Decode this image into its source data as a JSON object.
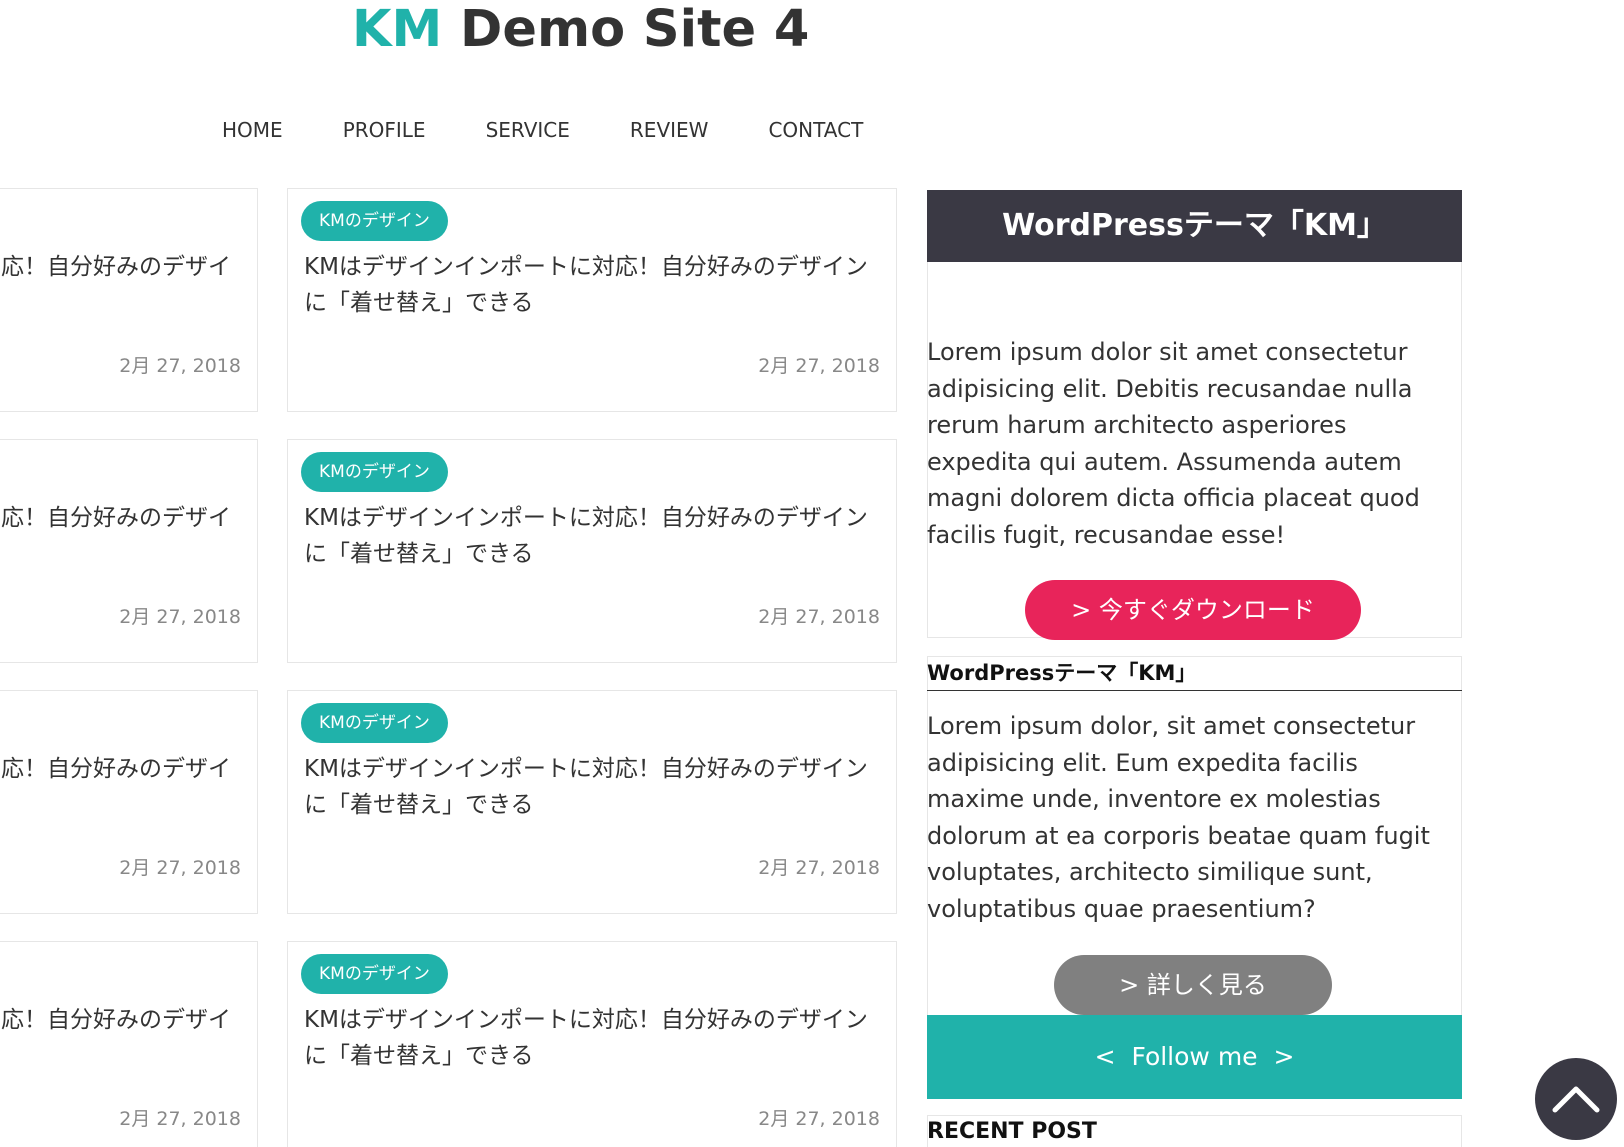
{
  "site": {
    "title_accent": "KM",
    "title_rest": " Demo Site 4"
  },
  "nav": [
    {
      "label": "HOME"
    },
    {
      "label": "PROFILE"
    },
    {
      "label": "SERVICE"
    },
    {
      "label": "REVIEW"
    },
    {
      "label": "CONTACT"
    }
  ],
  "posts_left": [
    {
      "title": "応！自分好みのデザイ",
      "date": "2月 27, 2018"
    },
    {
      "title": "応！自分好みのデザイ",
      "date": "2月 27, 2018"
    },
    {
      "title": "応！自分好みのデザイ",
      "date": "2月 27, 2018"
    },
    {
      "title": "応！自分好みのデザイ",
      "date": "2月 27, 2018"
    }
  ],
  "posts_right": [
    {
      "tag": "KMのデザイン",
      "title": "KMはデザインインポートに対応！自分好みのデザインに「着せ替え」できる",
      "date": "2月 27, 2018"
    },
    {
      "tag": "KMのデザイン",
      "title": "KMはデザインインポートに対応！自分好みのデザインに「着せ替え」できる",
      "date": "2月 27, 2018"
    },
    {
      "tag": "KMのデザイン",
      "title": "KMはデザインインポートに対応！自分好みのデザインに「着せ替え」できる",
      "date": "2月 27, 2018"
    },
    {
      "tag": "KMのデザイン",
      "title": "KMはデザインインポートに対応！自分好みのデザインに「着せ替え」できる",
      "date": "2月 27, 2018"
    }
  ],
  "sidebar": {
    "widget1": {
      "title": "WordPressテーマ「KM」",
      "text": "Lorem ipsum dolor sit amet consectetur adipisicing elit. Debitis recusandae nulla rerum harum architecto asperiores expedita qui autem. Assumenda autem magni dolorem dicta officia placeat quod facilis fugit, recusandae esse!",
      "button": "> 今すぐダウンロード"
    },
    "widget2": {
      "title": "WordPressテーマ「KM」",
      "text": "Lorem ipsum dolor, sit amet consectetur adipisicing elit. Eum expedita facilis maxime unde, inventore ex molestias dolorum at ea corporis beatae quam fugit voluptates, architecto similique sunt, voluptatibus quae praesentium?",
      "button": "> 詳しく見る"
    },
    "follow": "<  Follow me  >",
    "recent_title": "RECENT POST"
  },
  "icons": {
    "back_to_top": "chevron-up-icon"
  },
  "colors": {
    "accent": "#20b2aa",
    "dark": "#3a3944",
    "cta": "#e8245a",
    "muted_button": "#808080"
  }
}
